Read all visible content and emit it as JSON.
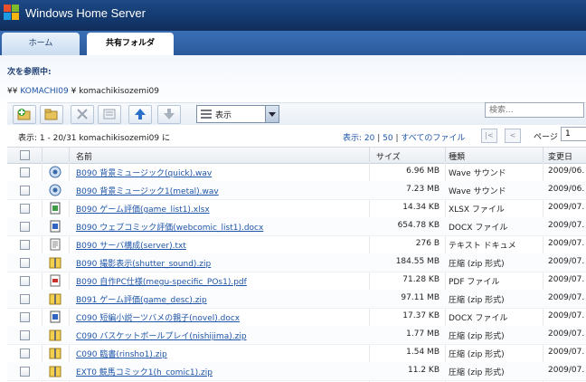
{
  "app": {
    "title": "Windows Home Server"
  },
  "tabs": [
    {
      "label": "ホーム"
    },
    {
      "label": "共有フォルダ"
    }
  ],
  "browsing": {
    "heading": "次を参照中:"
  },
  "breadcrumb": {
    "prefix": "¥¥",
    "root": "KOMACHI09",
    "sep": "¥",
    "folder": "komachikisozemi09"
  },
  "toolbar": {
    "view_label": "表示"
  },
  "search": {
    "placeholder": "検索..."
  },
  "status": {
    "range": "表示: 1 - 20/31 komachikisozemi09 に",
    "perpage_label": "表示:",
    "opt20": "20",
    "opt50": "50",
    "opt_all": "すべてのファイル",
    "page_label": "ページ",
    "page_value": "1"
  },
  "columns": {
    "name": "名前",
    "size": "サイズ",
    "type": "種類",
    "modified": "変更日"
  },
  "files": [
    {
      "name": "B090 背景ミュージック(quick).wav",
      "size": "6.96 MB",
      "type": "Wave サウンド",
      "date": "2009/06.",
      "icon": "audio-icon"
    },
    {
      "name": "B090 背景ミュージック1(metal).wav",
      "size": "7.23 MB",
      "type": "Wave サウンド",
      "date": "2009/06.",
      "icon": "audio-icon"
    },
    {
      "name": "B090 ゲーム評価(game_list1).xlsx",
      "size": "14.34 KB",
      "type": "XLSX ファイル",
      "date": "2009/07.",
      "icon": "spreadsheet-icon"
    },
    {
      "name": "B090 ウェブコミック評価(webcomic_list1).docx",
      "size": "654.78 KB",
      "type": "DOCX ファイル",
      "date": "2009/07.",
      "icon": "document-icon"
    },
    {
      "name": "B090 サーバ構成(server).txt",
      "size": "276 B",
      "type": "テキスト ドキュメ",
      "date": "2009/07.",
      "icon": "text-file-icon"
    },
    {
      "name": "B090 撮影表示(shutter_sound).zip",
      "size": "184.55 MB",
      "type": "圧縮 (zip 形式)",
      "date": "2009/07.",
      "icon": "zip-icon"
    },
    {
      "name": "B090 自作PC仕様(megu-specific_POs1).pdf",
      "size": "71.28 KB",
      "type": "PDF ファイル",
      "date": "2009/07.",
      "icon": "pdf-icon"
    },
    {
      "name": "B091 ゲーム評価(game_desc).zip",
      "size": "97.11 MB",
      "type": "圧縮 (zip 形式)",
      "date": "2009/07.",
      "icon": "zip-icon"
    },
    {
      "name": "C090 短編小説ーツバメの親子(novel).docx",
      "size": "17.37 KB",
      "type": "DOCX ファイル",
      "date": "2009/07.",
      "icon": "document-icon"
    },
    {
      "name": "C090 バスケットボールプレイ(nishijima).zip",
      "size": "1.77 MB",
      "type": "圧縮 (zip 形式)",
      "date": "2009/07.",
      "icon": "zip-icon"
    },
    {
      "name": "C090 臨書(rinsho1).zip",
      "size": "1.54 MB",
      "type": "圧縮 (zip 形式)",
      "date": "2009/07.",
      "icon": "zip-icon"
    },
    {
      "name": "EXT0 競馬コミック1(h_comic1).zip",
      "size": "11.2 KB",
      "type": "圧縮 (zip 形式)",
      "date": "2009/07.",
      "icon": "zip-icon"
    }
  ]
}
